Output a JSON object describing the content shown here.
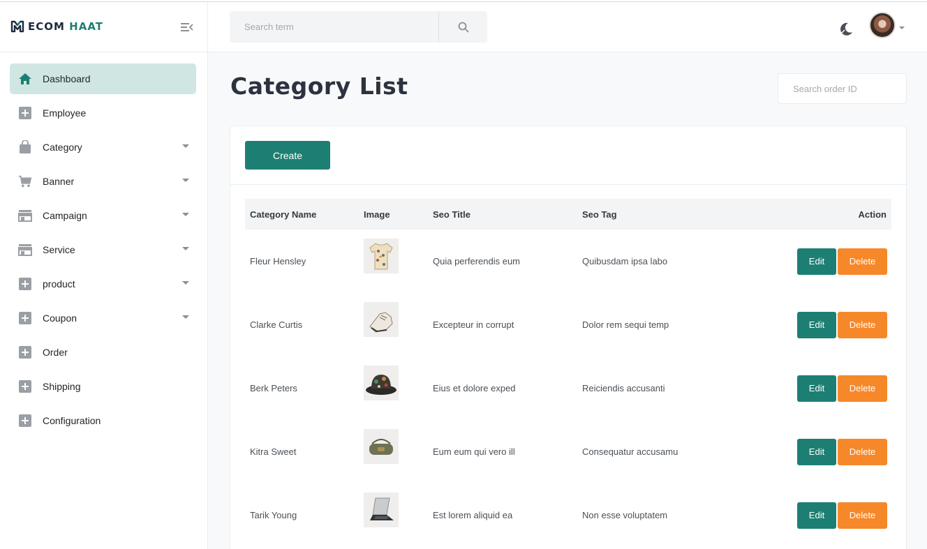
{
  "brand": {
    "name_part1": "ECOM ",
    "name_part2": "HAAT"
  },
  "header": {
    "search_placeholder": "Search term"
  },
  "sidebar": {
    "items": [
      {
        "label": "Dashboard",
        "icon": "home-icon",
        "active": true,
        "expandable": false
      },
      {
        "label": "Employee",
        "icon": "plus-square-icon",
        "active": false,
        "expandable": false
      },
      {
        "label": "Category",
        "icon": "bag-icon",
        "active": false,
        "expandable": true
      },
      {
        "label": "Banner",
        "icon": "cart-icon",
        "active": false,
        "expandable": true
      },
      {
        "label": "Campaign",
        "icon": "store-icon",
        "active": false,
        "expandable": true
      },
      {
        "label": "Service",
        "icon": "store-icon",
        "active": false,
        "expandable": true
      },
      {
        "label": "product",
        "icon": "plus-square-icon",
        "active": false,
        "expandable": true
      },
      {
        "label": "Coupon",
        "icon": "plus-square-icon",
        "active": false,
        "expandable": true
      },
      {
        "label": "Order",
        "icon": "plus-square-icon",
        "active": false,
        "expandable": false
      },
      {
        "label": "Shipping",
        "icon": "plus-square-icon",
        "active": false,
        "expandable": false
      },
      {
        "label": "Configuration",
        "icon": "plus-square-icon",
        "active": false,
        "expandable": false
      }
    ]
  },
  "main": {
    "title": "Category List",
    "order_search_placeholder": "Search order ID",
    "create_label": "Create",
    "table": {
      "headers": [
        "Category Name",
        "Image",
        "Seo Title",
        "Seo Tag",
        "Action"
      ],
      "rows": [
        {
          "name": "Fleur Hensley",
          "image": "shirt-image",
          "seo_title": "Quia perferendis eum",
          "seo_tag": "Quibusdam ipsa labo"
        },
        {
          "name": "Clarke Curtis",
          "image": "shoe-image",
          "seo_title": "Excepteur in corrupt",
          "seo_tag": "Dolor rem sequi temp"
        },
        {
          "name": "Berk Peters",
          "image": "hat-image",
          "seo_title": "Eius et dolore exped",
          "seo_tag": "Reiciendis accusanti"
        },
        {
          "name": "Kitra Sweet",
          "image": "bag-image",
          "seo_title": "Eum eum qui vero ill",
          "seo_tag": "Consequatur accusamu"
        },
        {
          "name": "Tarik Young",
          "image": "laptop-stand-image",
          "seo_title": "Est lorem aliquid ea",
          "seo_tag": "Non esse voluptatem"
        }
      ],
      "edit_label": "Edit",
      "delete_label": "Delete"
    }
  },
  "colors": {
    "primary": "#1d7f73",
    "danger": "#f6882a",
    "active_bg": "#d0e6e2"
  }
}
